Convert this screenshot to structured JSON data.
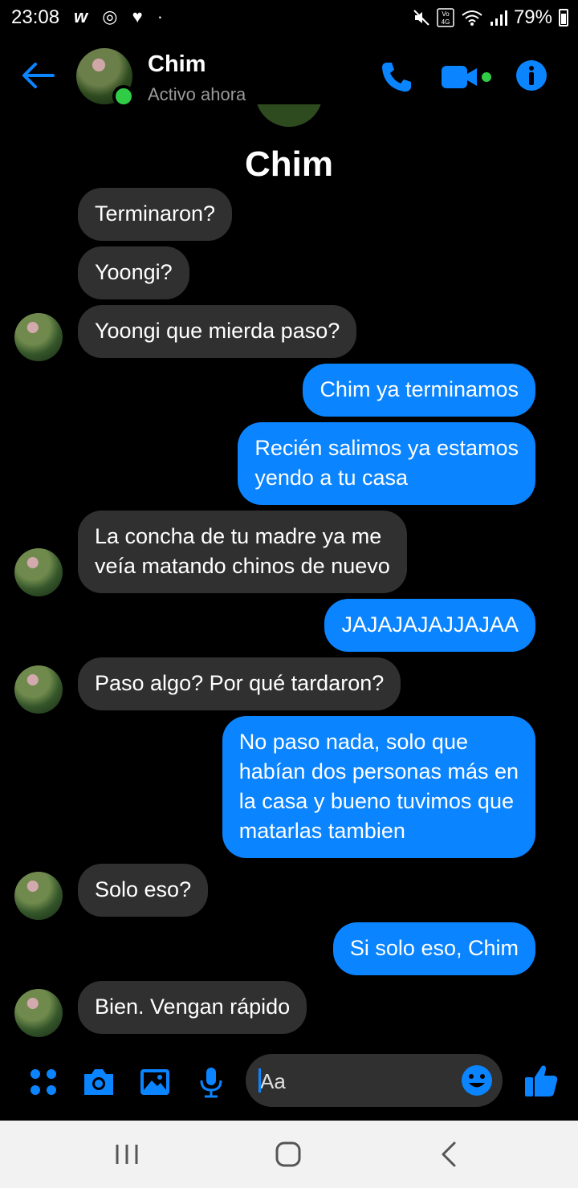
{
  "status_bar": {
    "time": "23:08",
    "left_icons": [
      "w-icon",
      "instagram-icon",
      "heart-icon",
      "dot"
    ],
    "right_icons": [
      "mute-icon",
      "volte-4g-icon",
      "wifi-icon",
      "signal-icon"
    ],
    "battery": "79%"
  },
  "header": {
    "contact_name": "Chim",
    "status": "Activo ahora",
    "accent_color": "#0a84ff",
    "online_color": "#31cc46"
  },
  "chat": {
    "title": "Chim",
    "messages": [
      {
        "from": "them",
        "text": "Terminaron?"
      },
      {
        "from": "them",
        "text": "Yoongi?"
      },
      {
        "from": "them",
        "text": "Yoongi que mierda paso?"
      },
      {
        "from": "me",
        "text": "Chim ya terminamos"
      },
      {
        "from": "me",
        "lines": [
          "Recién salimos ya estamos",
          "yendo a tu casa"
        ]
      },
      {
        "from": "them",
        "lines": [
          "La concha de tu madre ya me",
          "veía matando chinos de nuevo"
        ]
      },
      {
        "from": "me",
        "text": "JAJAJAJAJJAJAA"
      },
      {
        "from": "them",
        "text": "Paso algo? Por qué tardaron?"
      },
      {
        "from": "me",
        "lines": [
          "No paso nada, solo que",
          "habían dos personas más en",
          "la casa y bueno tuvimos que",
          "matarlas tambien"
        ]
      },
      {
        "from": "them",
        "text": "Solo eso?"
      },
      {
        "from": "me",
        "text": "Si solo eso, Chim"
      },
      {
        "from": "them",
        "text": "Bien. Vengan rápido"
      }
    ]
  },
  "composer": {
    "placeholder": "Aa",
    "icons": [
      "menu-dots-icon",
      "camera-icon",
      "gallery-icon",
      "microphone-icon",
      "emoji-icon",
      "thumbs-up-icon"
    ]
  },
  "nav_bar": {
    "buttons": [
      "recent-apps",
      "home",
      "back"
    ]
  }
}
